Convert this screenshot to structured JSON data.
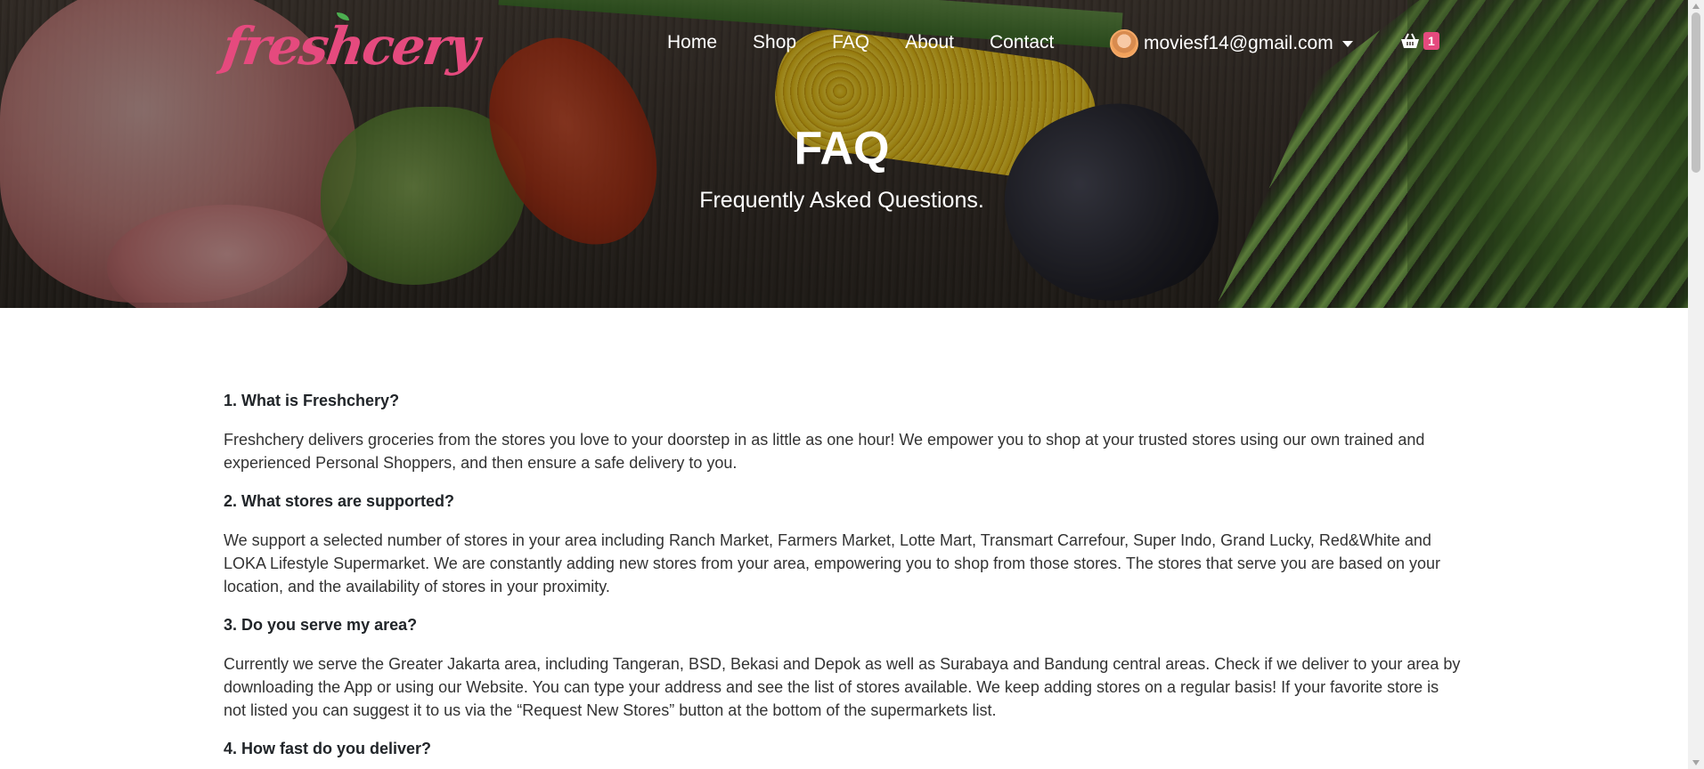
{
  "brand": {
    "logo_text": "freshcery",
    "accent_color": "#e54a7e"
  },
  "nav": {
    "items": [
      {
        "label": "Home"
      },
      {
        "label": "Shop"
      },
      {
        "label": "FAQ"
      },
      {
        "label": "About"
      },
      {
        "label": "Contact"
      }
    ],
    "user_email": "moviesf14@gmail.com",
    "cart_count": "1"
  },
  "hero": {
    "title": "FAQ",
    "subtitle": "Frequently Asked Questions."
  },
  "faq": [
    {
      "question": "1. What is Freshchery?",
      "answer": "Freshchery delivers groceries from the stores you love to your doorstep in as little as one hour! We empower you to shop at your trusted stores using our own trained and experienced Personal Shoppers, and then ensure a safe delivery to you."
    },
    {
      "question": "2. What stores are supported?",
      "answer": "We support a selected number of stores in your area including Ranch Market, Farmers Market, Lotte Mart, Transmart Carrefour, Super Indo, Grand Lucky, Red&White and LOKA Lifestyle Supermarket. We are constantly adding new stores from your area, empowering you to shop from those stores. The stores that serve you are based on your location, and the availability of stores in your proximity."
    },
    {
      "question": "3. Do you serve my area?",
      "answer": "Currently we serve the Greater Jakarta area, including Tangeran, BSD, Bekasi and Depok as well as Surabaya and Bandung central areas. Check if we deliver to your area by downloading the App or using our Website. You can type your address and see the list of stores available. We keep adding stores on a regular basis! If your favorite store is not listed you can suggest it to us via the  “Request New Stores” button at the bottom of the  supermarkets list."
    },
    {
      "question": "4. How fast do you deliver?",
      "answer": ""
    }
  ]
}
